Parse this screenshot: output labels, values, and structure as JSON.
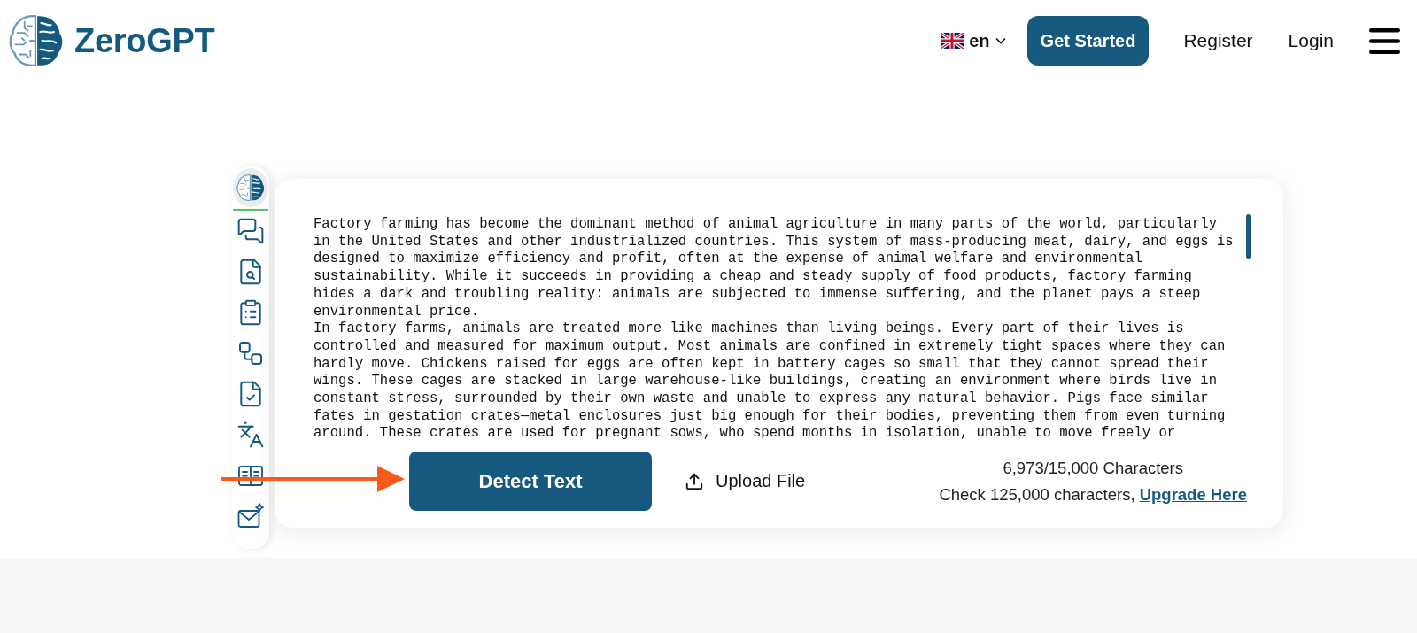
{
  "header": {
    "logo": {
      "name": "ZeroGPT"
    },
    "language": {
      "code": "en"
    },
    "nav": [
      {
        "kind": "button",
        "label": "Get Started"
      },
      {
        "kind": "link",
        "label": "Register"
      },
      {
        "kind": "link",
        "label": "Login"
      }
    ]
  },
  "sidebar": {
    "items": [
      {
        "selected": true
      },
      {
        "selected": false
      },
      {
        "selected": false
      },
      {
        "selected": false
      },
      {
        "selected": false
      },
      {
        "selected": false
      },
      {
        "selected": false
      },
      {
        "selected": false
      },
      {
        "selected": false
      }
    ]
  },
  "editor": {
    "paragraphs": [
      "Factory farming has become the dominant method of animal agriculture in many parts of the world, particularly in the United States and other industrialized countries. This system of mass-producing meat, dairy, and eggs is designed to maximize efficiency and profit, often at the expense of animal welfare and environmental sustainability. While it succeeds in providing a cheap and steady supply of food products, factory farming hides a dark and troubling reality: animals are subjected to immense suffering, and the planet pays a steep environmental price.",
      "In factory farms, animals are treated more like machines than living beings. Every part of their lives is controlled and measured for maximum output. Most animals are confined in extremely tight spaces where they can hardly move. Chickens raised for eggs are often kept in battery cages so small that they cannot spread their wings. These cages are stacked in large warehouse-like buildings, creating an environment where birds live in constant stress, surrounded by their own waste and unable to express any natural behavior. Pigs face similar fates in gestation crates—metal enclosures just big enough for their bodies, preventing them from even turning around. These crates are used for pregnant sows, who spend months in isolation, unable to move freely or"
    ],
    "detect_button": "Detect Text",
    "upload_button": "Upload File",
    "counter": "6,973/15,000 Characters",
    "upgrade_note": {
      "text": "Check 125,000 characters,",
      "link": "Upgrade Here"
    }
  }
}
